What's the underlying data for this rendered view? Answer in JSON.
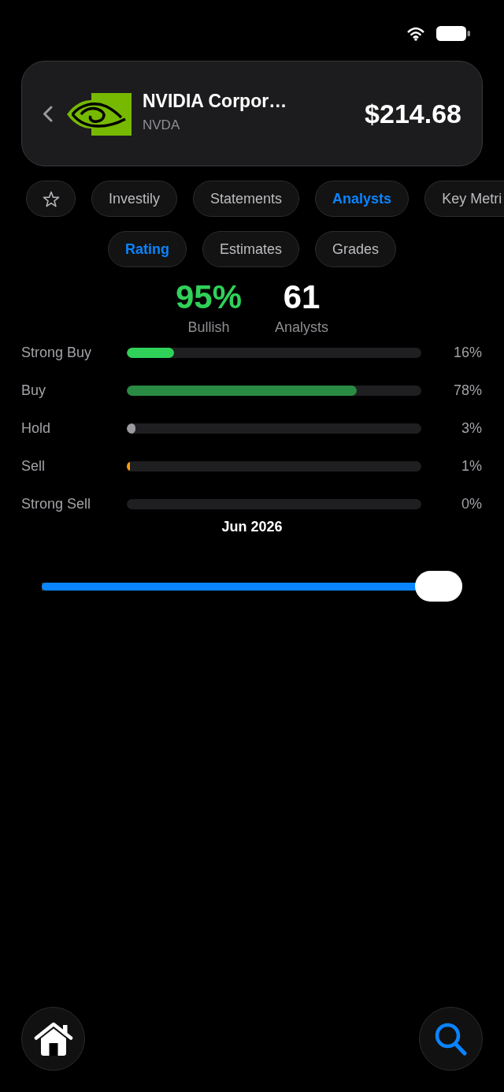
{
  "header": {
    "company_name": "NVIDIA Corpor…",
    "ticker": "NVDA",
    "price": "$214.68"
  },
  "favorite_button": {
    "on": false
  },
  "tabs": [
    {
      "label": "Investily",
      "selected": false
    },
    {
      "label": "Statements",
      "selected": false
    },
    {
      "label": "Analysts",
      "selected": true
    },
    {
      "label": "Key Metri",
      "selected": false
    }
  ],
  "sub_tabs": [
    {
      "label": "Rating",
      "selected": true
    },
    {
      "label": "Estimates",
      "selected": false
    },
    {
      "label": "Grades",
      "selected": false
    }
  ],
  "summary": [
    {
      "kind": "bullish",
      "value": "95%",
      "label": "Bullish"
    },
    {
      "kind": "count",
      "value": "61",
      "label": "Analysts"
    }
  ],
  "ratings": [
    {
      "label": "Strong Buy",
      "level": 0.16,
      "reading": "16%",
      "color": "#30d158"
    },
    {
      "label": "Buy",
      "level": 0.78,
      "reading": "78%",
      "color": "#2a8c44"
    },
    {
      "label": "Hold",
      "level": 0.03,
      "reading": "3%",
      "color": "#9a9a9f"
    },
    {
      "label": "Sell",
      "level": 0.01,
      "reading": "1%",
      "color": "#ff9f0a"
    },
    {
      "label": "Strong Sell",
      "reading": "0%"
    }
  ],
  "period": "Jun 2026",
  "slider": {
    "level": 1
  }
}
